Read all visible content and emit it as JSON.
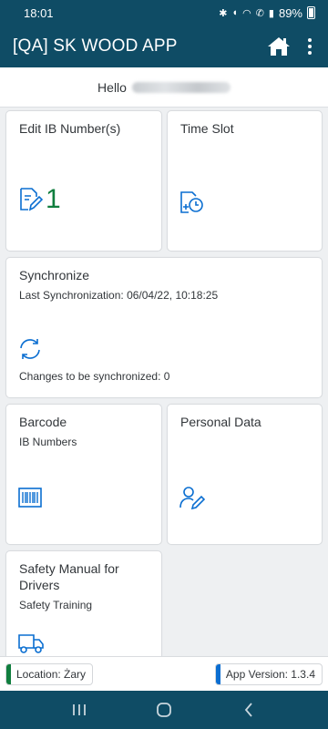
{
  "status_bar": {
    "time": "18:01",
    "battery": "89%"
  },
  "app_bar": {
    "title": "[QA] SK WOOD APP"
  },
  "greeting": {
    "prefix": "Hello"
  },
  "tiles": {
    "edit_ib": {
      "title": "Edit IB Number(s)",
      "count": "1"
    },
    "time_slot": {
      "title": "Time Slot"
    },
    "synchronize": {
      "title": "Synchronize",
      "subtitle": "Last Synchronization: 06/04/22, 10:18:25",
      "footer": "Changes to be synchronized: 0"
    },
    "barcode": {
      "title": "Barcode",
      "subtitle": "IB Numbers"
    },
    "personal_data": {
      "title": "Personal Data"
    },
    "safety_manual": {
      "title": "Safety Manual for Drivers",
      "subtitle": "Safety Training"
    }
  },
  "footer": {
    "location": "Location: Żary",
    "version": "App Version: 1.3.4"
  },
  "colors": {
    "header": "#0f4c65",
    "icon": "#0a6ed1",
    "kpi": "#107e3e",
    "location_bar": "#107e3e",
    "version_bar": "#0a6ed1"
  }
}
